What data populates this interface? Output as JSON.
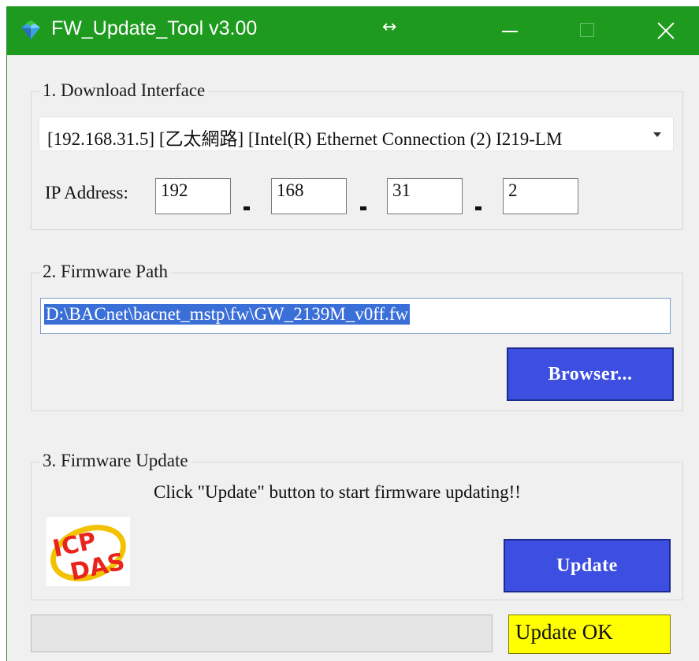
{
  "window": {
    "title": "FW_Update_Tool v3.00",
    "icons": {
      "app": "app-gem-icon",
      "resize": "resize-horizontal-icon"
    },
    "colors": {
      "titlebar": "#1e9a1e",
      "button": "#3c4fe0",
      "status_bg": "#ffff00",
      "selection": "#3a6fd8"
    }
  },
  "download_interface": {
    "title": "1. Download Interface",
    "selected_interface": "[192.168.31.5] [乙太網路] [Intel(R) Ethernet Connection (2) I219-LM",
    "ip_label": "IP Address:",
    "ip": [
      "192",
      "168",
      "31",
      "2"
    ]
  },
  "firmware_path": {
    "title": "2. Firmware Path",
    "path": "D:\\BACnet\\bacnet_mstp\\fw\\GW_2139M_v0ff.fw",
    "browse_label": "Browser..."
  },
  "firmware_update": {
    "title": "3. Firmware Update",
    "hint": "Click \"Update\" button to start firmware updating!!",
    "logo_text": "ICP DAS",
    "update_label": "Update"
  },
  "status_bar": {
    "progress": 0,
    "status": "Update OK"
  }
}
